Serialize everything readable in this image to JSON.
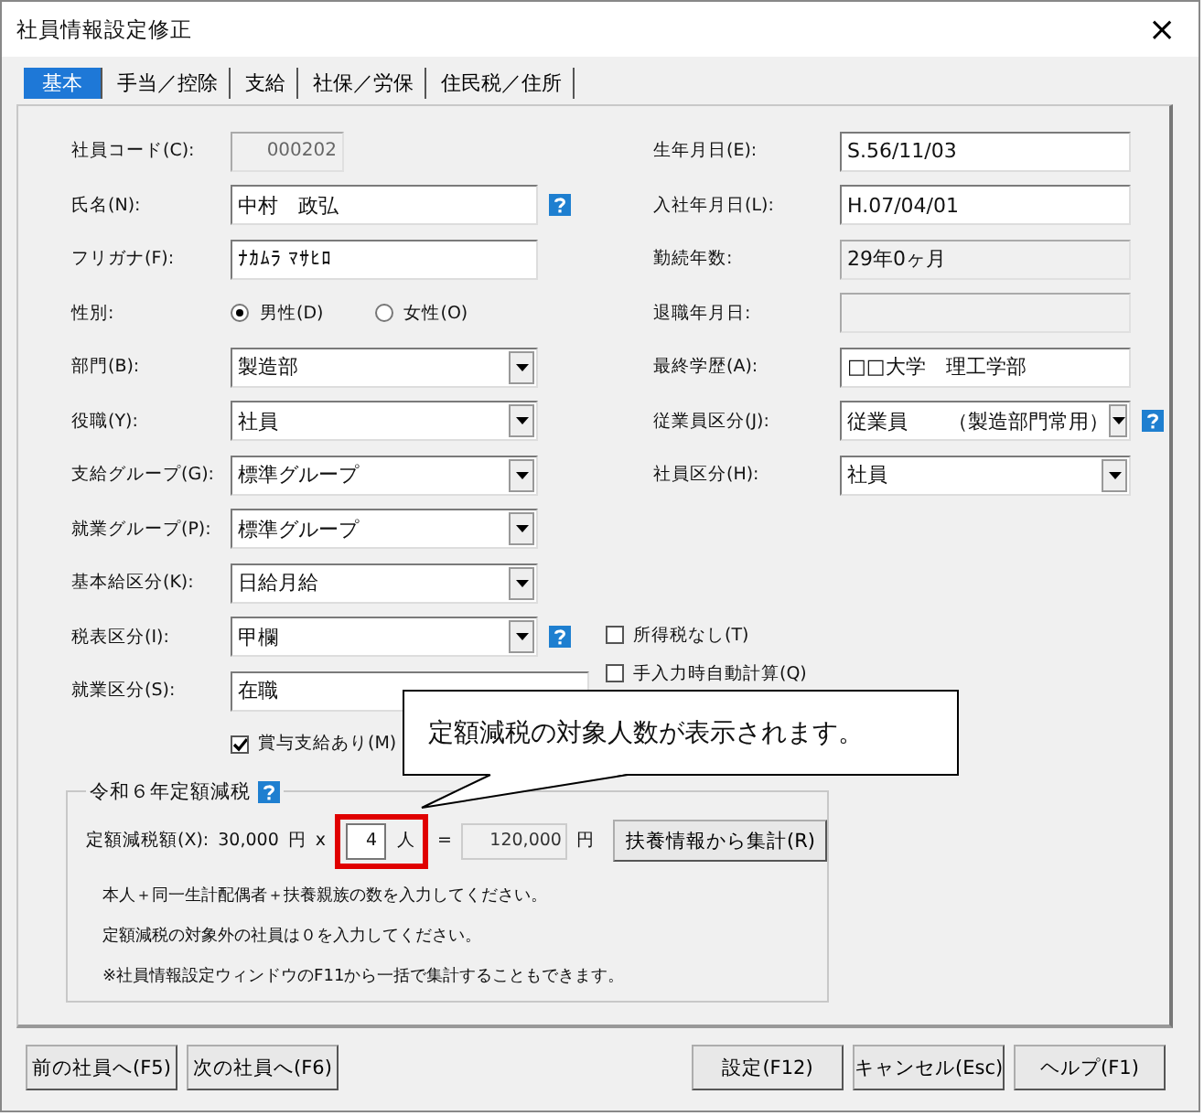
{
  "window": {
    "title": "社員情報設定修正",
    "close": "×"
  },
  "tabs": [
    {
      "label": "基本",
      "selected": true
    },
    {
      "label": "手当／控除",
      "selected": false
    },
    {
      "label": "支給",
      "selected": false
    },
    {
      "label": "社保／労保",
      "selected": false
    },
    {
      "label": "住民税／住所",
      "selected": false
    }
  ],
  "left_fields": [
    {
      "label": "社員コード(C):",
      "kind": "readonly",
      "value": "000202",
      "help": false
    },
    {
      "label": "氏名(N):",
      "kind": "text",
      "value": "中村　政弘",
      "help": true
    },
    {
      "label": "フリガナ(F):",
      "kind": "text",
      "value": "ﾅｶﾑﾗ ﾏｻﾋﾛ",
      "help": false
    },
    {
      "label": "性別:",
      "kind": "radio",
      "options": [
        {
          "label": "男性(D)",
          "selected": true
        },
        {
          "label": "女性(O)",
          "selected": false
        }
      ],
      "help": false
    },
    {
      "label": "部門(B):",
      "kind": "combo",
      "value": "製造部",
      "help": false
    },
    {
      "label": "役職(Y):",
      "kind": "combo",
      "value": "社員",
      "help": false
    },
    {
      "label": "支給グループ(G):",
      "kind": "combo",
      "value": "標準グループ",
      "help": false
    },
    {
      "label": "就業グループ(P):",
      "kind": "combo",
      "value": "標準グループ",
      "help": false
    },
    {
      "label": "基本給区分(K):",
      "kind": "combo",
      "value": "日給月給",
      "help": false
    },
    {
      "label": "税表区分(I):",
      "kind": "combo",
      "value": "甲欄",
      "help": true
    },
    {
      "label": "就業区分(S):",
      "kind": "covered",
      "value": "在職",
      "help": false
    }
  ],
  "bonus_checkbox": {
    "label": "賞与支給あり(M)",
    "checked": true
  },
  "right_fields": [
    {
      "label": "生年月日(E):",
      "kind": "text",
      "value": "S.56/11/03",
      "help": false
    },
    {
      "label": "入社年月日(L):",
      "kind": "text",
      "value": "H.07/04/01",
      "help": false
    },
    {
      "label": "勤続年数:",
      "kind": "readonly",
      "value": "29年0ヶ月",
      "help": false
    },
    {
      "label": "退職年月日:",
      "kind": "readonly",
      "help": false
    },
    {
      "label": "最終学歴(A):",
      "kind": "text",
      "value": "□□大学　理工学部",
      "help": false
    },
    {
      "label": "従業員区分(J):",
      "kind": "combo",
      "value": "従業員　　（製造部門常用）",
      "help": true
    },
    {
      "label": "社員区分(H):",
      "kind": "combo",
      "value": "社員",
      "help": false
    }
  ],
  "right_checkboxes": [
    {
      "label": "所得税なし(T)",
      "checked": false
    },
    {
      "label": "手入力時自動計算(Q)",
      "checked": false
    }
  ],
  "tax_reduction": {
    "title": "令和６年定額減税",
    "label": "定額減税額(X):",
    "amount": "30,000",
    "yen": "円",
    "times": "x",
    "count": "4",
    "unit": "人",
    "equals": "=",
    "total": "120,000",
    "total_yen": "円",
    "button": "扶養情報から集計(R)",
    "notes": [
      "本人＋同一生計配偶者＋扶養親族の数を入力してください。",
      "定額減税の対象外の社員は０を入力してください。",
      "※社員情報設定ウィンドウのF11から一括で集計することもできます。"
    ]
  },
  "callout": "定額減税の対象人数が表示されます。",
  "buttons_left": [
    "前の社員へ(F5)",
    "次の社員へ(F6)"
  ],
  "buttons_right": [
    "設定(F12)",
    "キャンセル(Esc)",
    "ヘルプ(F1)"
  ]
}
